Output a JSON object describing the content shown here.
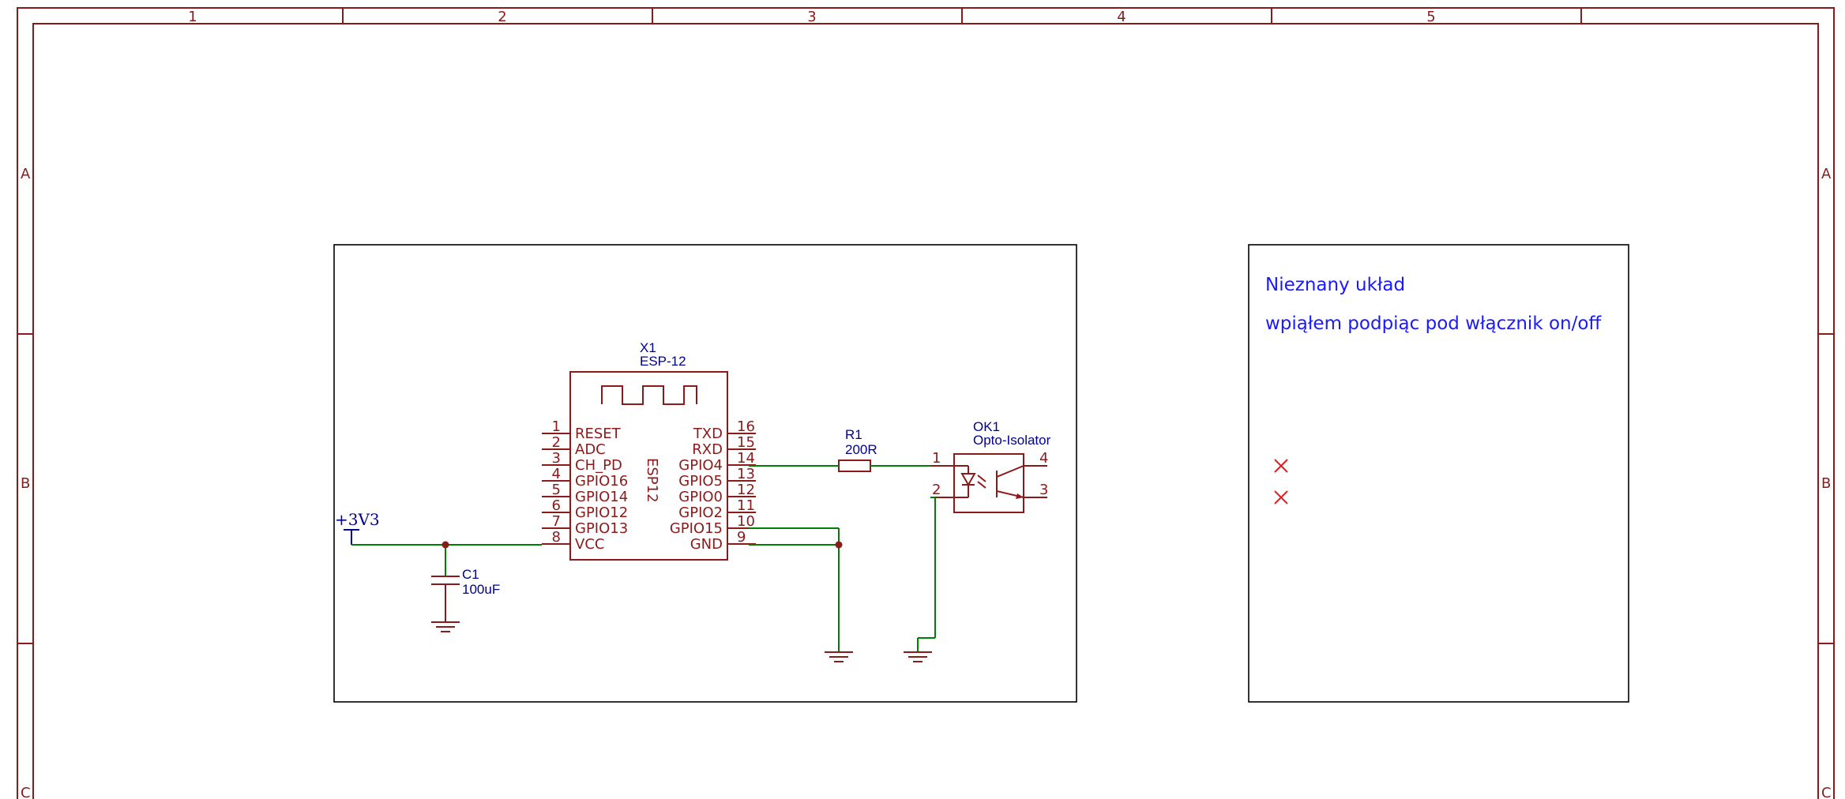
{
  "frame": {
    "columns": [
      "1",
      "2",
      "3",
      "4",
      "5"
    ],
    "rows": [
      "A",
      "B",
      "C"
    ]
  },
  "components": {
    "x1": {
      "ref": "X1",
      "value": "ESP-12",
      "body_label": "ESP12",
      "left_pins": [
        {
          "num": "1",
          "name": "RESET"
        },
        {
          "num": "2",
          "name": "ADC"
        },
        {
          "num": "3",
          "name": "CH_PD"
        },
        {
          "num": "4",
          "name": "GPIO16"
        },
        {
          "num": "5",
          "name": "GPIO14"
        },
        {
          "num": "6",
          "name": "GPIO12"
        },
        {
          "num": "7",
          "name": "GPIO13"
        },
        {
          "num": "8",
          "name": "VCC"
        }
      ],
      "right_pins": [
        {
          "num": "16",
          "name": "TXD"
        },
        {
          "num": "15",
          "name": "RXD"
        },
        {
          "num": "14",
          "name": "GPIO4"
        },
        {
          "num": "13",
          "name": "GPIO5"
        },
        {
          "num": "12",
          "name": "GPIO0"
        },
        {
          "num": "11",
          "name": "GPIO2"
        },
        {
          "num": "10",
          "name": "GPIO15"
        },
        {
          "num": "9",
          "name": "GND"
        }
      ]
    },
    "r1": {
      "ref": "R1",
      "value": "200R"
    },
    "c1": {
      "ref": "C1",
      "value": "100uF"
    },
    "ok1": {
      "ref": "OK1",
      "value": "Opto-Isolator",
      "pins": {
        "p1": "1",
        "p2": "2",
        "p3": "3",
        "p4": "4"
      }
    },
    "power": {
      "label": "+3V3"
    }
  },
  "notes": {
    "line1": "Nieznany układ",
    "line2": "wpiąłem podpiąc pod włącznik on/off"
  },
  "colors": {
    "frame": "#8b1a1a",
    "wire": "#008000",
    "component": "#8b1a1a",
    "reference": "#00008b",
    "note": "#1a1aff",
    "no_connect": "#e02020"
  }
}
